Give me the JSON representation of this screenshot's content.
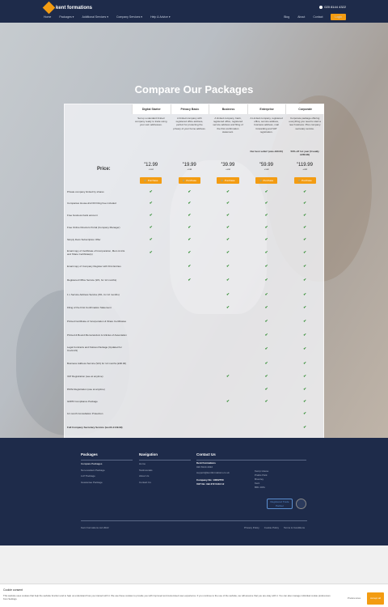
{
  "header": {
    "brand_light": "kent",
    "brand_bold": "formations",
    "phone": "020 8144 4322",
    "menu": [
      "Home",
      "Packages ▾",
      "Additional Services ▾",
      "Company Services ▾",
      "Help & Advice ▾"
    ],
    "menu_right": [
      "Blog",
      "About",
      "Contact"
    ],
    "login_label": "Login"
  },
  "hero": {
    "title": "Compare Our Packages",
    "price_label": "Price:"
  },
  "packages": [
    {
      "name": "Digital Starter",
      "desc": "Set up a standard limited company ready to trade using your own addresses.",
      "note": "",
      "price": "12.99",
      "vat": "+vat",
      "button": "Purchase"
    },
    {
      "name": "Privacy Basic",
      "desc": "A limited company with registered office address, perfect for protecting the privacy of your home address.",
      "note": "",
      "price": "19.99",
      "vat": "+vat",
      "button": "Purchase"
    },
    {
      "name": "Business",
      "desc": "A limited company, bank, registered office, registered service address and filing of the first confirmation statement.",
      "note": "",
      "price": "39.99",
      "vat": "+vat",
      "button": "Purchase"
    },
    {
      "name": "Enterprise",
      "desc": "A Limited company, registered office, service address, business address, mail forwarding and VAT registration.",
      "note": "Our best seller! (was £90.00)",
      "price": "59.99",
      "vat": "+vat",
      "button": "Purchase"
    },
    {
      "name": "Corporate",
      "desc": "Corporate package offering everything you need to start a new business. Plus company secretary service.",
      "note": "50% off 1st year (Usually £239.99)",
      "price": "119.99",
      "vat": "+vat",
      "button": "Purchase"
    }
  ],
  "features": [
    {
      "label": "Private company limited by shares",
      "checks": [
        1,
        1,
        1,
        1,
        1
      ]
    },
    {
      "label": "Companies House £12.00 Filing Fee included",
      "checks": [
        1,
        1,
        1,
        1,
        1
      ]
    },
    {
      "label": "Free business bank account",
      "checks": [
        1,
        1,
        1,
        1,
        1
      ]
    },
    {
      "label": "Free Online Directors Portal (Company Manager)",
      "checks": [
        1,
        1,
        1,
        1,
        1
      ]
    },
    {
      "label": "Simply Docs Subscription Offer",
      "checks": [
        1,
        1,
        1,
        1,
        1
      ]
    },
    {
      "label": "Email copy of Certificate of Incorporation, Mem & Arts and Share Certificate(s)",
      "checks": [
        1,
        1,
        1,
        1,
        1
      ]
    },
    {
      "label": "Email copy of Company Register with First Entries",
      "checks": [
        0,
        1,
        1,
        1,
        1
      ]
    },
    {
      "label": "Registered Office Service (W1, for 12 months)",
      "checks": [
        0,
        1,
        1,
        1,
        1
      ]
    },
    {
      "label": "1 x Service Address Service (W1, for 12 months)",
      "checks": [
        0,
        0,
        1,
        1,
        1
      ]
    },
    {
      "label": "Filing of the First Confirmation Statement",
      "checks": [
        0,
        0,
        1,
        1,
        1
      ]
    },
    {
      "label": "Printed Certificate of Incorporation & Share Certificates",
      "checks": [
        0,
        0,
        0,
        1,
        1
      ]
    },
    {
      "label": "Printed & Bound Memorandum & Articles of Association",
      "checks": [
        0,
        0,
        0,
        1,
        1
      ]
    },
    {
      "label": "Legal Contracts and Notices Package (Updated for Covid-19)",
      "checks": [
        0,
        0,
        0,
        1,
        1
      ]
    },
    {
      "label": "Business Address Service (W1) for 12 months (£90.00)",
      "checks": [
        0,
        0,
        0,
        1,
        1
      ]
    },
    {
      "label": "VAT Registration (see at anytime)",
      "checks": [
        0,
        0,
        1,
        1,
        1
      ]
    },
    {
      "label": "PAYE Registration (use at anytime)",
      "checks": [
        0,
        0,
        0,
        1,
        1
      ]
    },
    {
      "label": "GDPR Compliance Package",
      "checks": [
        0,
        0,
        1,
        1,
        1
      ]
    },
    {
      "label": "12 month Consultation Protection",
      "checks": [
        0,
        0,
        0,
        0,
        1
      ]
    },
    {
      "label": "Full Company Secretary Service (worth £149.99)",
      "checks": [
        0,
        0,
        0,
        0,
        1
      ]
    }
  ],
  "footer": {
    "packages_title": "Packages",
    "packages_links": [
      "Compare Packages",
      "Non-resident Package",
      "LLP Package",
      "Guarantee Package"
    ],
    "nav_title": "Navigation",
    "nav_links": [
      "Home",
      "Testimonials",
      "About Us",
      "Contact Us"
    ],
    "contact_title": "Contact Us",
    "contact_company": "Kent Formations",
    "contact_phone": "020 8144 4322",
    "contact_email": "support@kentformations.co.uk",
    "company_no": "Company No: 13002750",
    "vat_no": "VAT No: GB 372 0444 12",
    "address": [
      "Kemp House",
      "Prabis Park",
      "Bromley",
      "Kent",
      "BR1 1RG"
    ],
    "badge_text": "Registered Trade Partner",
    "copyright": "Kent Formations Ltd 2022",
    "legal": [
      "Privacy Policy",
      "Cookie Policy",
      "Terms & Conditions"
    ]
  },
  "cookie": {
    "title": "Cookie consent",
    "text": "This website uses cookies that help the website function and to help us understand how you interact with it. We use these cookies to provide you with improved and customised user-experience. If you continue to the use of the website, we will assume that you are okay with it. You can also manage individual cookie preferences from Settings.",
    "prefs_label": "Preferences",
    "accept_label": "Accept all"
  },
  "colors": {
    "navy": "#1e2b4a",
    "accent": "#f39c12",
    "check": "#2e8b2e"
  }
}
